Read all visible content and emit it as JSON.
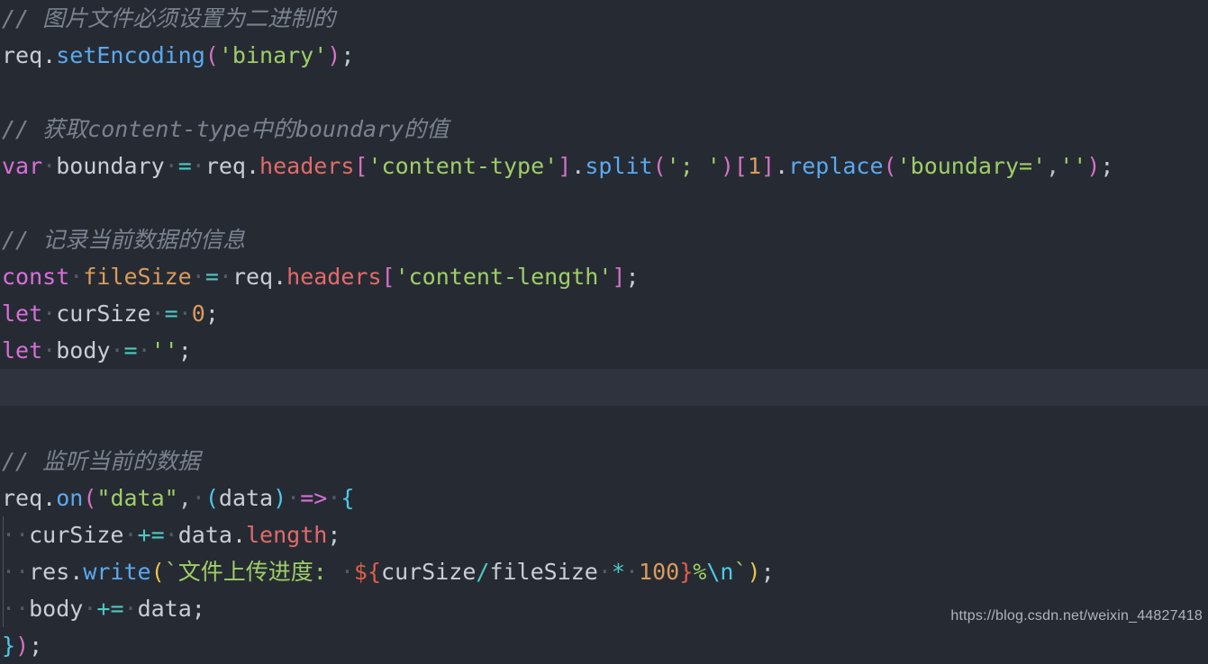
{
  "editor": {
    "background_color": "#262b33",
    "active_line_color": "#2e333e",
    "lines": [
      {
        "id": 1,
        "text": "// 图片文件必须设置为二进制的"
      },
      {
        "id": 2,
        "text": "req.setEncoding('binary');"
      },
      {
        "id": 3,
        "text": ""
      },
      {
        "id": 4,
        "text": "// 获取content-type中的boundary的值"
      },
      {
        "id": 5,
        "text": "var boundary = req.headers['content-type'].split('; ')[1].replace('boundary=','');"
      },
      {
        "id": 6,
        "text": ""
      },
      {
        "id": 7,
        "text": "// 记录当前数据的信息"
      },
      {
        "id": 8,
        "text": "const fileSize = req.headers['content-length'];"
      },
      {
        "id": 9,
        "text": "let curSize = 0;"
      },
      {
        "id": 10,
        "text": "let body = '';"
      },
      {
        "id": 11,
        "text": ""
      },
      {
        "id": 12,
        "text": ""
      },
      {
        "id": 13,
        "text": "// 监听当前的数据"
      },
      {
        "id": 14,
        "text": "req.on(\"data\", (data) => {"
      },
      {
        "id": 15,
        "text": "  curSize += data.length;"
      },
      {
        "id": 16,
        "text": "  res.write(`文件上传进度: ${curSize/fileSize * 100}%\\n`);"
      },
      {
        "id": 17,
        "text": "  body += data;"
      },
      {
        "id": 18,
        "text": "});"
      }
    ],
    "tokens": {
      "comment1": "// 图片文件必须设置为二进制的",
      "comment2": "// 获取content-type中的boundary的值",
      "comment3": "// 记录当前数据的信息",
      "comment4": "// 监听当前的数据",
      "req": "req",
      "dot": ".",
      "setEncoding": "setEncoding",
      "binary_string": "'binary'",
      "semicolon": ";",
      "var": "var",
      "boundary": "boundary",
      "assign": "=",
      "headers": "headers",
      "content_type_string": "'content-type'",
      "split": "split",
      "split_arg": "'; '",
      "index_one": "1",
      "replace": "replace",
      "boundary_eq_string": "'boundary='",
      "empty_string": "''",
      "comma": ",",
      "const": "const",
      "fileSize": "fileSize",
      "content_length_string": "'content-length'",
      "let": "let",
      "curSize": "curSize",
      "zero": "0",
      "body": "body",
      "on": "on",
      "data_string": "\"data\"",
      "data_param": "data",
      "arrow": "=>",
      "brace_open": "{",
      "plus_assign": "+=",
      "data_ident": "data",
      "length": "length",
      "res": "res",
      "write": "write",
      "backtick": "`",
      "template_text": "文件上传进度: ",
      "interp_open": "${",
      "slash": "/",
      "star": "*",
      "hundred": "100",
      "interp_close": "}",
      "percent": "%",
      "newline_escape": "\\n",
      "brace_close": "}",
      "paren_open": "(",
      "paren_close": ")",
      "bracket_open": "[",
      "bracket_close": "]",
      "space_dot": "·"
    }
  },
  "watermark": {
    "url": "https://blog.csdn.net/weixin_44827418"
  }
}
